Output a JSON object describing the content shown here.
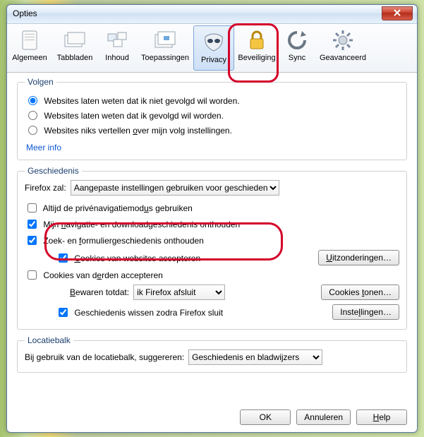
{
  "window": {
    "title": "Opties"
  },
  "toolbar": {
    "items": [
      {
        "id": "general",
        "label": "Algemeen"
      },
      {
        "id": "tabs",
        "label": "Tabbladen"
      },
      {
        "id": "content",
        "label": "Inhoud"
      },
      {
        "id": "applications",
        "label": "Toepassingen"
      },
      {
        "id": "privacy",
        "label": "Privacy"
      },
      {
        "id": "security",
        "label": "Beveiliging"
      },
      {
        "id": "sync",
        "label": "Sync"
      },
      {
        "id": "advanced",
        "label": "Geavanceerd"
      }
    ],
    "selected": "privacy"
  },
  "tracking": {
    "legend": "Volgen",
    "opt_no_track": "Websites laten weten dat ik niet gevolgd wil worden.",
    "opt_track": "Websites laten weten dat ik gevolgd wil worden.",
    "opt_nothing_pre": "Websites niks vertellen ",
    "opt_nothing_u": "o",
    "opt_nothing_post": "ver mijn volg instellingen.",
    "more_info": "Meer info",
    "selected": "no_track"
  },
  "history": {
    "legend": "Geschiedenis",
    "firefox_will": "Firefox zal:",
    "mode_selected": "Aangepaste instellingen gebruiken voor geschiedenis",
    "always_private_pre": "Altijd de privénavigatiemod",
    "always_private_u": "u",
    "always_private_post": "s gebruiken",
    "remember_nav_pre": "Mijn ",
    "remember_nav_u": "n",
    "remember_nav_post": "avigatie- en downloadgeschiedenis onthouden",
    "remember_forms_pre": "Zoek- en ",
    "remember_forms_u": "f",
    "remember_forms_post": "ormuliergeschiedenis onthouden",
    "accept_cookies_u": "C",
    "accept_cookies_post": "ookies van websites accepteren",
    "third_party_pre": "Cookies van d",
    "third_party_u": "e",
    "third_party_post": "rden accepteren",
    "keep_until_u": "B",
    "keep_until_post": "ewaren totdat:",
    "keep_until_value": "ik Firefox afsluit",
    "clear_on_close": "Geschiedenis wissen zodra Firefox sluit",
    "exceptions_u": "U",
    "exceptions_post": "itzonderingen…",
    "show_cookies_pre": "Cookies ",
    "show_cookies_u": "t",
    "show_cookies_post": "onen…",
    "settings_pre": "Inste",
    "settings_u": "l",
    "settings_post": "lingen…",
    "always_private_checked": false,
    "remember_nav_checked": true,
    "remember_forms_checked": true,
    "accept_cookies_checked": true,
    "third_party_checked": false,
    "clear_on_close_checked": true
  },
  "locationbar": {
    "legend": "Locatiebalk",
    "label": "Bij gebruik van de locatiebalk, suggereren:",
    "value": "Geschiedenis en bladwijzers"
  },
  "footer": {
    "ok": "OK",
    "cancel": "Annuleren",
    "help_u": "H",
    "help_post": "elp"
  }
}
